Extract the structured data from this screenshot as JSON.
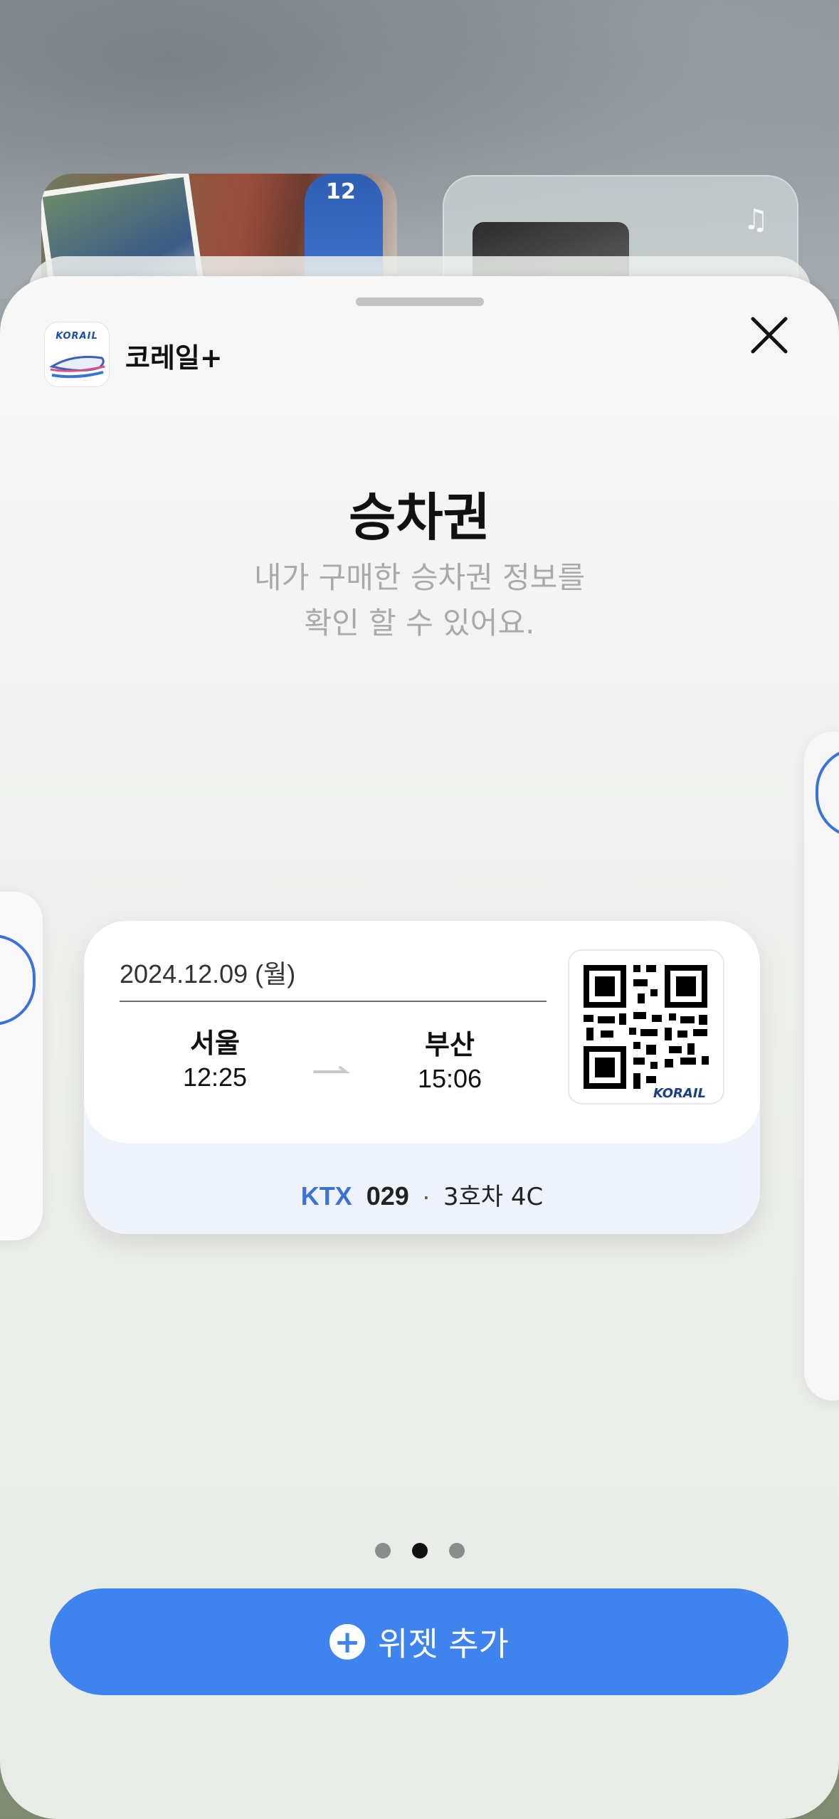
{
  "app": {
    "name": "코레일+",
    "icon_text": "KORAIL"
  },
  "widget": {
    "title": "승차권",
    "subtitle_line1": "내가 구매한 승차권 정보를",
    "subtitle_line2": "확인 할 수 있어요."
  },
  "ticket": {
    "date": "2024.12.09 (월)",
    "departure": {
      "station": "서울",
      "time": "12:25"
    },
    "arrival": {
      "station": "부산",
      "time": "15:06"
    },
    "train_type": "KTX",
    "train_number": "029",
    "separator": "·",
    "seat": "3호차 4C",
    "qr_logo": "KORAIL"
  },
  "background": {
    "jersey_number": "12",
    "music_icon": "music-note-icon"
  },
  "pagination": {
    "count": 3,
    "active_index": 1
  },
  "add_button": {
    "label": "위젯 추가",
    "icon": "plus-icon"
  },
  "colors": {
    "accent": "#3f84ee",
    "ktx": "#3a73d8"
  }
}
